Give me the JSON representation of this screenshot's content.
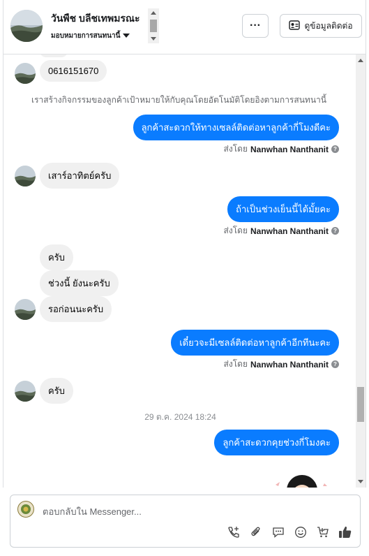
{
  "header": {
    "customer_name": "วันพืช บลีชเทพมรณะ",
    "assign_label": "มอบหมายการสนทนานี้",
    "more_label": "···",
    "contact_button": "ดูข้อมูลติดต่อ"
  },
  "messages": {
    "m1": "0616151670",
    "system_note": "เราสร้างกิจกรรมของลูกค้าเป้าหมายให้กับคุณโดยอัตโนมัติโดยอิงตามการสนทนานี้",
    "m2": "ลูกค้าสะดวกให้ทางเซลล์ติดต่อหาลูกค้ากี่โมงดีคะ",
    "m3": "เสาร์อาทิตย์ครับ",
    "m4": "ถ้าเป็นช่วงเย็นนี้ได้มั้ยคะ",
    "m5": "ครับ",
    "m6": "ช่วงนี้ ยังนะครับ",
    "m7": "รอก่อนนะครับ",
    "m8": "เดี๋ยวจะมีเซลล์ติดต่อหาลูกค้าอีกทีนะคะ",
    "m9": "ครับ",
    "timestamp": "29 ต.ค. 2024 18:24",
    "m10": "ลูกค้าสะดวกคุยช่วงกี่โมงคะ"
  },
  "sent_by": {
    "prefix": "ส่งโดย",
    "agent": "Nanwhan Nanthanit"
  },
  "composer": {
    "placeholder": "ตอบกลับใน Messenger..."
  },
  "colors": {
    "outgoing": "#0a7cff",
    "incoming": "#f0f0f0"
  },
  "icons": [
    "chevron-down-icon",
    "contact-card-icon",
    "add-call-icon",
    "attachment-icon",
    "saved-reply-icon",
    "emoji-icon",
    "add-to-cart-icon",
    "like-icon"
  ]
}
